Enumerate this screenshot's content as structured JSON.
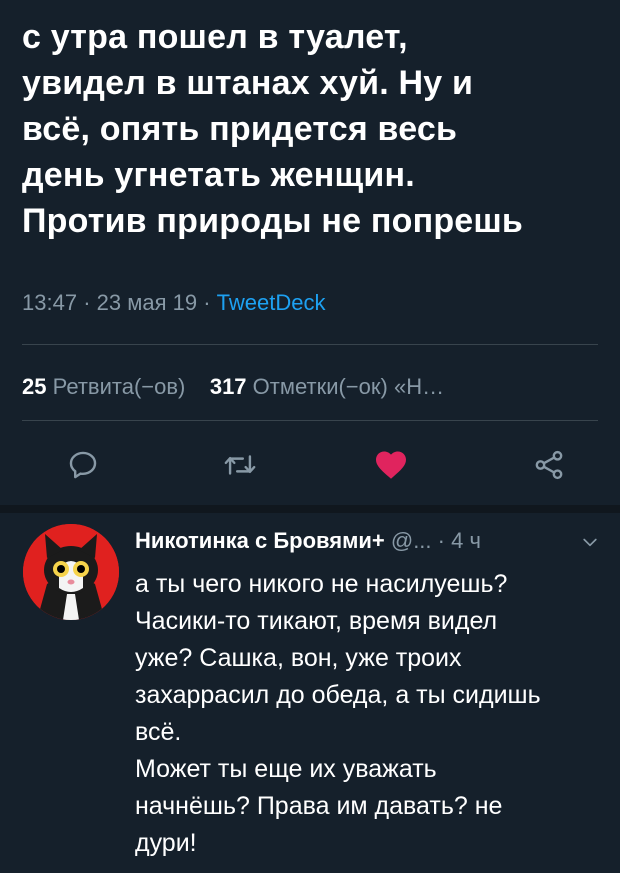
{
  "tweet": {
    "text": "с утра пошел в туалет,\nувидел в штанах хуй. Ну и\nвсё, опять придется весь\nдень угнетать женщин.\nПротив природы не попрешь",
    "time": "13:47",
    "date": "23 мая 19",
    "separator": "·",
    "source": "TweetDeck"
  },
  "stats": {
    "retweets_count": "25",
    "retweets_label": "Ретвита(−ов)",
    "likes_count": "317",
    "likes_label": "Отметки(−ок) «Н…"
  },
  "actions": [
    {
      "icon": "reply-icon"
    },
    {
      "icon": "retweet-icon"
    },
    {
      "icon": "heart-icon",
      "color": "#e0245e",
      "active": true
    },
    {
      "icon": "share-icon"
    }
  ],
  "reply": {
    "author": "Никотинка с Бровями+",
    "handle": "@...",
    "time": "· 4 ч",
    "text": "а ты чего никого не насилуешь?\nЧасики-то тикают, время видел\nуже? Сашка, вон, уже троих\nзахаррасил до обеда, а ты сидишь\nвсё.\nМожет ты еще их уважать\nначнёшь? Права им давать? не\nдури!"
  },
  "colors": {
    "background": "#15202b",
    "muted": "#8899a6",
    "link": "#1da1f2",
    "like": "#e0245e"
  }
}
